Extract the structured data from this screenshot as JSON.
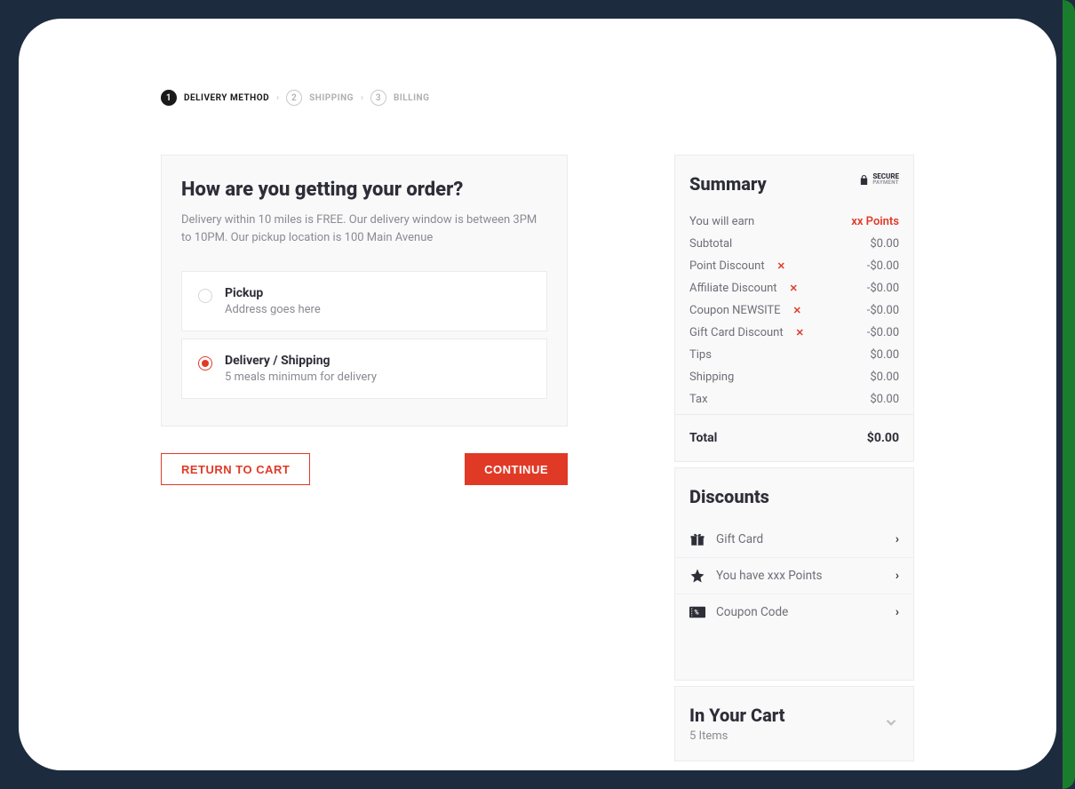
{
  "steps": [
    {
      "num": "1",
      "label": "DELIVERY METHOD"
    },
    {
      "num": "2",
      "label": "SHIPPING"
    },
    {
      "num": "3",
      "label": "BILLING"
    }
  ],
  "main": {
    "title": "How are you getting your order?",
    "desc": "Delivery within 10 miles is FREE. Our delivery window is between 3PM to 10PM. Our pickup location is 100 Main Avenue",
    "options": [
      {
        "title": "Pickup",
        "sub": "Address goes here",
        "selected": false
      },
      {
        "title": "Delivery / Shipping",
        "sub": "5 meals minimum for delivery",
        "selected": true
      }
    ]
  },
  "buttons": {
    "return": "RETURN TO CART",
    "continue": "CONTINUE"
  },
  "summary": {
    "title": "Summary",
    "secure_top": "SECURE",
    "secure_bottom": "PAYMENT",
    "earn_label": "You will earn",
    "earn_value": "xx Points",
    "lines": [
      {
        "label": "Subtotal",
        "value": "$0.00",
        "removable": false
      },
      {
        "label": "Point Discount",
        "value": "-$0.00",
        "removable": true
      },
      {
        "label": "Affiliate Discount",
        "value": "-$0.00",
        "removable": true
      },
      {
        "label": "Coupon NEWSITE",
        "value": "-$0.00",
        "removable": true
      },
      {
        "label": "Gift Card Discount",
        "value": "-$0.00",
        "removable": true
      },
      {
        "label": "Tips",
        "value": "$0.00",
        "removable": false
      },
      {
        "label": "Shipping",
        "value": "$0.00",
        "removable": false
      },
      {
        "label": "Tax",
        "value": "$0.00",
        "removable": false
      }
    ],
    "total_label": "Total",
    "total_value": "$0.00"
  },
  "discounts": {
    "title": "Discounts",
    "rows": [
      {
        "label": "Gift Card",
        "icon": "gift"
      },
      {
        "label": "You have xxx Points",
        "icon": "star"
      },
      {
        "label": "Coupon Code",
        "icon": "coupon"
      }
    ]
  },
  "cart": {
    "title": "In Your Cart",
    "sub": "5 Items"
  }
}
